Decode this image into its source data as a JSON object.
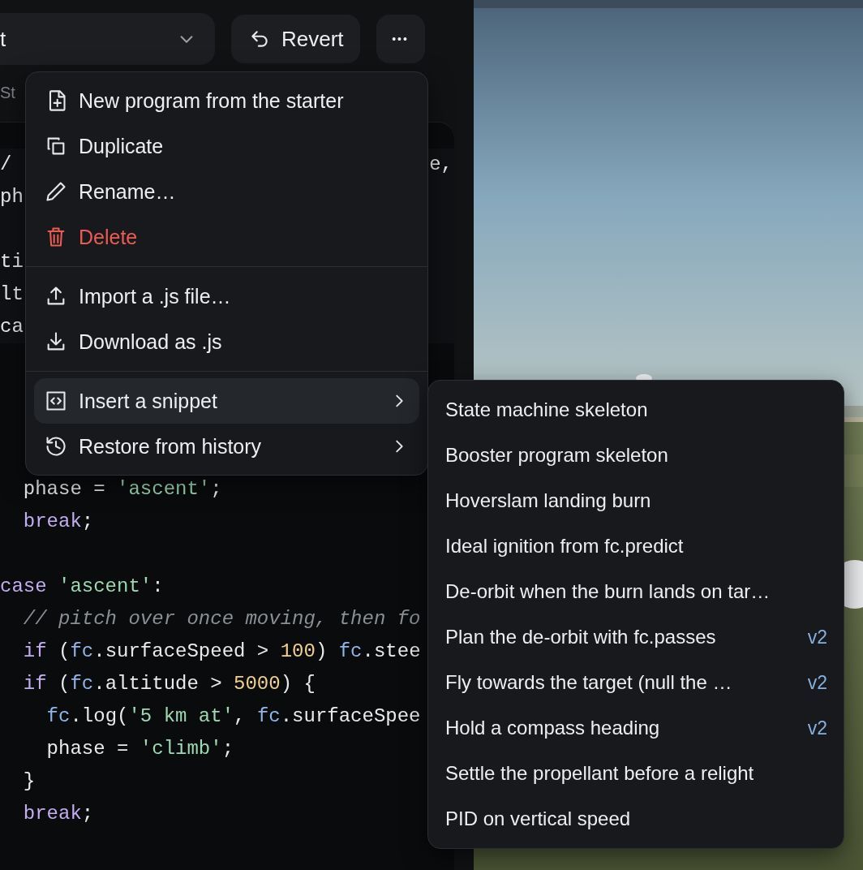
{
  "toolbar": {
    "program_select": {
      "value": "t"
    },
    "revert_button": {
      "label": "Revert"
    },
    "more_button": {
      "label": "•••"
    }
  },
  "status_text": "St",
  "editor": {
    "partial_lines": [
      {
        "kind": "code",
        "start": "/",
        "end": "e,"
      },
      {
        "kind": "code",
        "start": "ph"
      },
      {
        "kind": "blank"
      },
      {
        "kind": "code",
        "start": "ti"
      },
      {
        "kind": "code",
        "start": "lt"
      },
      {
        "kind": "code",
        "start": "ca"
      }
    ],
    "lines": [
      {
        "kind": "code",
        "tokens": [
          {
            "kind": "plain",
            "s": "  phase = "
          },
          {
            "kind": "string",
            "s": "'ascent'"
          },
          {
            "kind": "plain",
            "s": ";"
          }
        ]
      },
      {
        "kind": "code",
        "tokens": [
          {
            "kind": "keyword",
            "s": "  break"
          },
          {
            "kind": "plain",
            "s": ";"
          }
        ]
      },
      {
        "kind": "blank"
      },
      {
        "kind": "code",
        "tokens": [
          {
            "kind": "keyword",
            "s": "case"
          },
          {
            "kind": "string",
            "s": " 'ascent'"
          },
          {
            "kind": "plain",
            "s": ":"
          }
        ]
      },
      {
        "kind": "code",
        "tokens": [
          {
            "kind": "comment",
            "s": "  // pitch over once moving, then fo"
          }
        ]
      },
      {
        "kind": "code",
        "tokens": [
          {
            "kind": "keyword",
            "s": "  if"
          },
          {
            "kind": "plain",
            "s": " ("
          },
          {
            "kind": "object",
            "s": "fc"
          },
          {
            "kind": "plain",
            "s": ".surfaceSpeed > "
          },
          {
            "kind": "number",
            "s": "100"
          },
          {
            "kind": "plain",
            "s": ") "
          },
          {
            "kind": "object",
            "s": "fc"
          },
          {
            "kind": "plain",
            "s": ".stee"
          }
        ]
      },
      {
        "kind": "code",
        "tokens": [
          {
            "kind": "keyword",
            "s": "  if"
          },
          {
            "kind": "plain",
            "s": " ("
          },
          {
            "kind": "object",
            "s": "fc"
          },
          {
            "kind": "plain",
            "s": ".altitude > "
          },
          {
            "kind": "number",
            "s": "5000"
          },
          {
            "kind": "plain",
            "s": ") {"
          }
        ]
      },
      {
        "kind": "code",
        "tokens": [
          {
            "kind": "object",
            "s": "    fc"
          },
          {
            "kind": "plain",
            "s": ".log("
          },
          {
            "kind": "string",
            "s": "'5 km at'"
          },
          {
            "kind": "plain",
            "s": ", "
          },
          {
            "kind": "object",
            "s": "fc"
          },
          {
            "kind": "plain",
            "s": ".surfaceSpee"
          }
        ]
      },
      {
        "kind": "code",
        "tokens": [
          {
            "kind": "plain",
            "s": "    phase = "
          },
          {
            "kind": "string",
            "s": "'climb'"
          },
          {
            "kind": "plain",
            "s": ";"
          }
        ]
      },
      {
        "kind": "code",
        "tokens": [
          {
            "kind": "plain",
            "s": "  }"
          }
        ]
      },
      {
        "kind": "code",
        "tokens": [
          {
            "kind": "keyword",
            "s": "  break"
          },
          {
            "kind": "plain",
            "s": ";"
          }
        ]
      }
    ]
  },
  "menu": {
    "groups": [
      [
        {
          "label": "New program from the starter",
          "danger": false,
          "submenu": false,
          "selected": false
        },
        {
          "label": "Duplicate",
          "danger": false,
          "submenu": false,
          "selected": false
        },
        {
          "label": "Rename…",
          "danger": false,
          "submenu": false,
          "selected": false
        },
        {
          "label": "Delete",
          "danger": true,
          "submenu": false,
          "selected": false
        }
      ],
      [
        {
          "label": "Import a .js file…",
          "danger": false,
          "submenu": false,
          "selected": false
        },
        {
          "label": "Download as .js",
          "danger": false,
          "submenu": false,
          "selected": false
        }
      ],
      [
        {
          "label": "Insert a snippet",
          "danger": false,
          "submenu": true,
          "selected": true
        },
        {
          "label": "Restore from history",
          "danger": false,
          "submenu": true,
          "selected": false
        }
      ]
    ]
  },
  "submenu": {
    "items": [
      {
        "label": "State machine skeleton"
      },
      {
        "label": "Booster program skeleton"
      },
      {
        "label": "Hoverslam landing burn"
      },
      {
        "label": "Ideal ignition from fc.predict"
      },
      {
        "label": "De-orbit when the burn lands on tar…"
      },
      {
        "label": "Plan the de-orbit with fc.passes",
        "badge": "v2"
      },
      {
        "label": "Fly towards the target (null the …",
        "badge": "v2"
      },
      {
        "label": "Hold a compass heading",
        "badge": "v2"
      },
      {
        "label": "Settle the propellant before a relight"
      },
      {
        "label": "PID on vertical speed"
      }
    ]
  }
}
